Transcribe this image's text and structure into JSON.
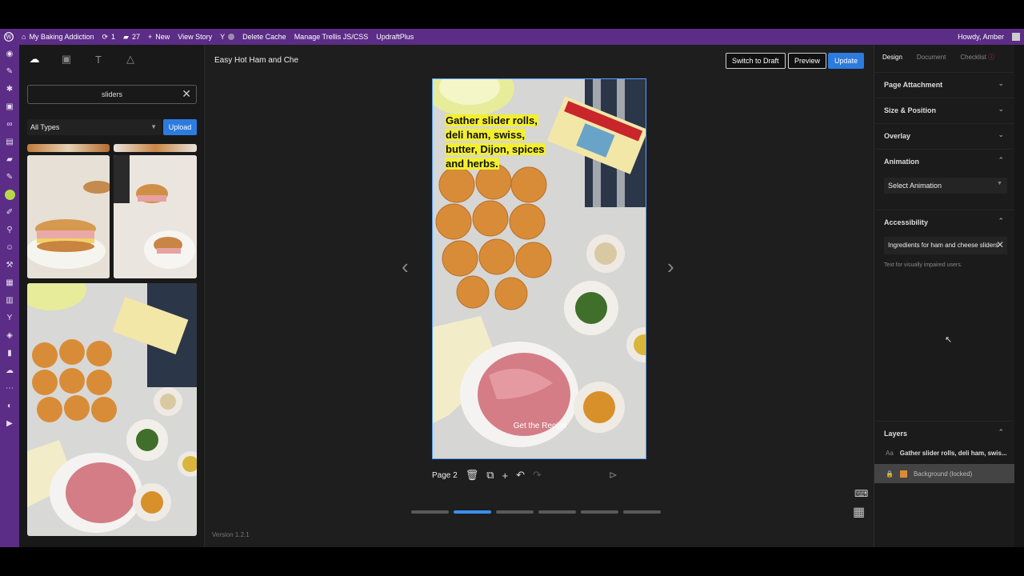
{
  "admin_bar": {
    "site_name": "My Baking Addiction",
    "updates_count": "1",
    "comments_count": "27",
    "new_label": "New",
    "view_story": "View Story",
    "delete_cache": "Delete Cache",
    "manage_trellis": "Manage Trellis JS/CSS",
    "updraft": "UpdraftPlus",
    "howdy": "Howdy, Amber"
  },
  "library": {
    "search_value": "sliders",
    "type_filter": "All Types",
    "upload_label": "Upload"
  },
  "editor": {
    "doc_title": "Easy Hot Ham and Che",
    "switch_draft": "Switch to Draft",
    "preview": "Preview",
    "update": "Update",
    "caption": "Gather slider rolls, deli ham, swiss, butter, Dijon, spices and herbs.",
    "cta": "Get the Recipe",
    "page_label": "Page 2",
    "version": "Version 1.2.1",
    "current_page": 2,
    "page_count": 6
  },
  "right_panel": {
    "tabs": [
      "Design",
      "Document",
      "Checklist"
    ],
    "sections": {
      "page_attachment": "Page Attachment",
      "size_position": "Size & Position",
      "overlay": "Overlay",
      "animation": "Animation",
      "accessibility": "Accessibility",
      "layers": "Layers"
    },
    "animation_select": "Select Animation",
    "alt_text": "Ingredients for ham and cheese sliders",
    "alt_hint": "Text for visually impaired users.",
    "layers": [
      {
        "icon": "Aa",
        "label": "Gather slider rolls, deli ham, swis..."
      },
      {
        "icon": "lock",
        "label": "Background (locked)"
      }
    ]
  },
  "colors": {
    "wp_purple": "#5b2d86",
    "accent_blue": "#2c7bdf",
    "caption_highlight": "#f3ef2e"
  }
}
